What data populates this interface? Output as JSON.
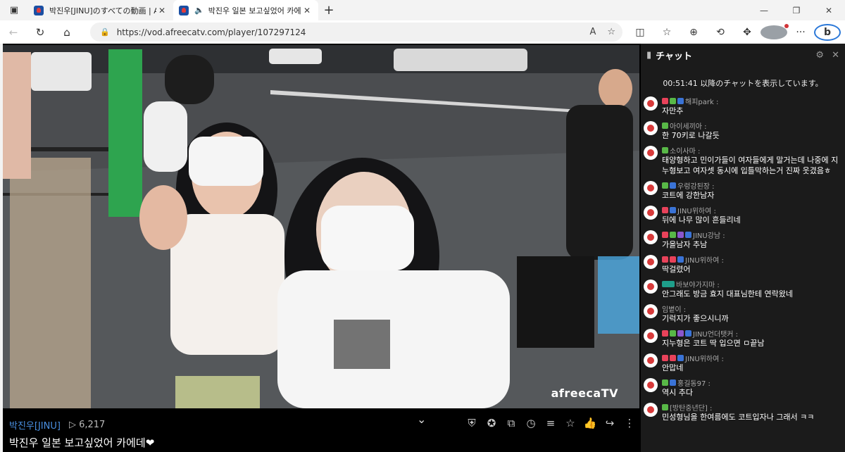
{
  "browser": {
    "tabs": [
      {
        "title": "박진우[JINU]のすべての動画 | Afreec"
      },
      {
        "title": "박진우 일본 보고싶었어 카에데"
      }
    ],
    "url": "https://vod.afreecatv.com/player/107297124"
  },
  "player": {
    "watermark": "afreecaTV",
    "bj_name": "박진우[JINU]",
    "views": "▷ 6,217",
    "title": "박진우 일본 보고싶었어 카에데❤"
  },
  "chat": {
    "header": "チャット",
    "notice": "00:51:41 以降のチャットを表示しています。",
    "messages": [
      {
        "user": "해피park :",
        "text": "자만추"
      },
      {
        "user": "아이세끼아 :",
        "text": "한 70키로 나갈듯"
      },
      {
        "user": "소이사마 :",
        "text": "태양형하고 민이가들이 여자들에게 말거는데 나중에 지누형보고 여자셋 동시에 입틀막하는거 진짜 웃겼음ㅎ"
      },
      {
        "user": "우렁강된장 :",
        "text": "코트에 강한남자"
      },
      {
        "user": "JINU위하여 :",
        "text": "뒤에 나무 많이 흔들리네"
      },
      {
        "user": "JINU강남 :",
        "text": "가을남자 추남"
      },
      {
        "user": "JINU위하여 :",
        "text": "딱걸렸어"
      },
      {
        "user": "바보야가지마 :",
        "text": "안그래도 방금 효지 대표님한테 연락왔네"
      },
      {
        "user": "임볕이 :",
        "text": "기럭지가 좋으시니까"
      },
      {
        "user": "JINU언더탯커 :",
        "text": "지누형은 코트 딱 입으면 ㅁ끝남"
      },
      {
        "user": "JINU위하여 :",
        "text": "안맙네"
      },
      {
        "user": "홍길동97 :",
        "text": "역시 추다"
      },
      {
        "user": "[방탄중년단] :",
        "text": "민성형님을 한여름에도 코트입자나 그래서 ㅋㅋ"
      }
    ]
  }
}
